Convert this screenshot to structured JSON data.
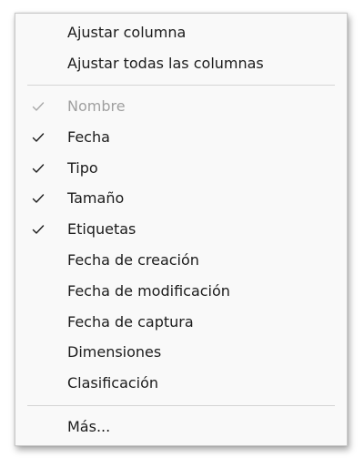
{
  "menu": {
    "items": [
      {
        "label": "Ajustar columna",
        "checked": false,
        "disabled": false
      },
      {
        "label": "Ajustar todas las columnas",
        "checked": false,
        "disabled": false
      },
      {
        "label": "Nombre",
        "checked": true,
        "disabled": true
      },
      {
        "label": "Fecha",
        "checked": true,
        "disabled": false
      },
      {
        "label": "Tipo",
        "checked": true,
        "disabled": false
      },
      {
        "label": "Tamaño",
        "checked": true,
        "disabled": false
      },
      {
        "label": "Etiquetas",
        "checked": true,
        "disabled": false
      },
      {
        "label": "Fecha de creación",
        "checked": false,
        "disabled": false
      },
      {
        "label": "Fecha de modificación",
        "checked": false,
        "disabled": false
      },
      {
        "label": "Fecha de captura",
        "checked": false,
        "disabled": false
      },
      {
        "label": "Dimensiones",
        "checked": false,
        "disabled": false
      },
      {
        "label": "Clasificación",
        "checked": false,
        "disabled": false
      },
      {
        "label": "Más...",
        "checked": false,
        "disabled": false
      }
    ],
    "icons": {
      "check": "checkmark-icon"
    }
  }
}
